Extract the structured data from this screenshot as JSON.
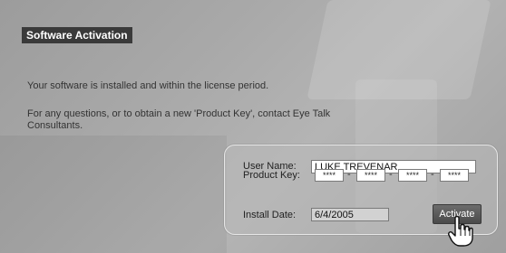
{
  "title": "Software Activation",
  "messages": [
    "Your software is installed and within the license period.",
    "For any questions, or to obtain a new 'Product Key', contact Eye Talk",
    "Consultants."
  ],
  "form": {
    "user_name_label": "User Name:",
    "user_name_value": "LUKE TREVENAR",
    "product_key_label": "Product Key:",
    "product_key_parts": [
      "****",
      "****",
      "****",
      "****"
    ],
    "install_date_label": "Install Date:",
    "install_date_value": "6/4/2005",
    "activate_label": "Activate"
  },
  "icons": {
    "cursor": "hand-pointer-icon"
  },
  "colors": {
    "title_bg": "#3a3a3a",
    "background": "#a6a6a6"
  }
}
